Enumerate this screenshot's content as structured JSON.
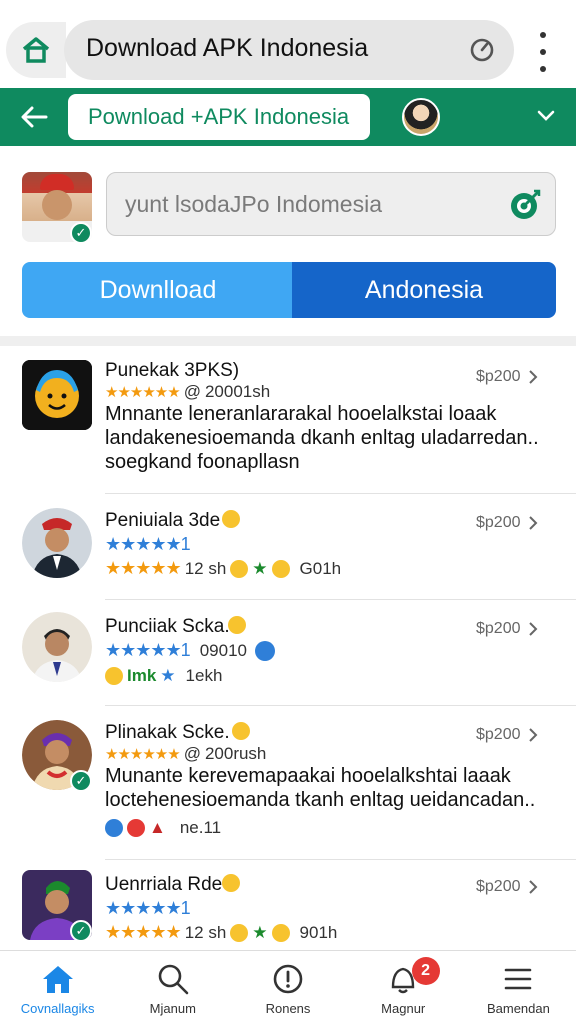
{
  "browser": {
    "url_text": "Download APK Indonesia"
  },
  "header": {
    "title": "Pownload +APK   Indonesia"
  },
  "search": {
    "placeholder": "yunt lsodaJPo Indomesia"
  },
  "buttons": {
    "download": "Downlload",
    "indonesia": "Andonesia"
  },
  "list": {
    "items": [
      {
        "name": "Punekak 3PKS)",
        "rating_stars": "★★★★★★",
        "rating_icon": "@",
        "rating_text": "20001sh",
        "price": "$p200",
        "desc_lines": [
          "Mnnante leneranlararakal hooelalkstai loaak",
          "landakenesioemanda dkanh enltag uladarredan..",
          "soegkand foonapllasn"
        ]
      },
      {
        "name": "Peniuiala 3de",
        "stars_blue": "★★★★★1",
        "stars_orange": "★★★★★",
        "meta_text": "12 sh",
        "meta_extra": "G01h",
        "price": "$p200"
      },
      {
        "name": "Punciiak Scka.",
        "stars_blue": "★★★★★1",
        "meta_text": "09010",
        "meta_line2_text": "1ekh",
        "meta_line2_label": "Imk",
        "price": "$p200"
      },
      {
        "name": "Plinakak Scke.",
        "rating_stars": "★★★★★★",
        "rating_icon": "@",
        "rating_text": "200rush",
        "price": "$p200",
        "desc_lines": [
          "Munante kerevemapaakai hooelalkshtai laaak",
          "loctehenesioemanda tkanh enltag ueidancadan.."
        ],
        "meta_text": "ne.11"
      },
      {
        "name": "Uenrriala Rde",
        "stars_blue": "★★★★★1",
        "stars_orange": "★★★★★",
        "meta_text": "12 sh",
        "meta_extra": "901h",
        "price": "$p200"
      }
    ]
  },
  "nav": {
    "items": [
      {
        "label": "Covnallagiks",
        "icon": "home-icon"
      },
      {
        "label": "Mjanum",
        "icon": "search-icon"
      },
      {
        "label": "Ronens",
        "icon": "info-icon"
      },
      {
        "label": "Magnur",
        "icon": "notification-icon"
      },
      {
        "label": "Bamendan",
        "icon": "menu-icon"
      }
    ],
    "badge_count": "2"
  },
  "colors": {
    "brand_green": "#0f8a5f",
    "button_light_blue": "#3fa7f3",
    "button_dark_blue": "#1565c9",
    "star_orange": "#f39a0f",
    "star_blue": "#2f7fd8",
    "active_nav": "#1b87e6",
    "badge_red": "#e53935"
  }
}
